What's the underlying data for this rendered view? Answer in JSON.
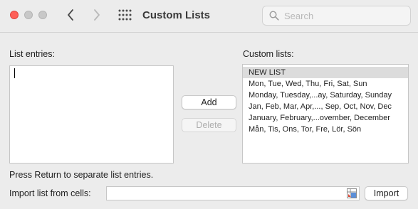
{
  "window": {
    "title": "Custom Lists"
  },
  "toolbar": {
    "back_icon": "chevron-left-icon",
    "forward_icon": "chevron-right-icon",
    "show_all_icon": "grid-icon"
  },
  "search": {
    "placeholder": "Search",
    "value": ""
  },
  "list_entries": {
    "label": "List entries:",
    "value": ""
  },
  "buttons": {
    "add": "Add",
    "delete": "Delete",
    "import": "Import"
  },
  "custom_lists": {
    "label": "Custom lists:",
    "items": [
      "NEW LIST",
      "Mon, Tue, Wed, Thu, Fri, Sat, Sun",
      "Monday, Tuesday,...ay, Saturday, Sunday",
      "Jan, Feb, Mar, Apr,..., Sep, Oct, Nov, Dec",
      "January, February,...ovember, December",
      "Mån, Tis, Ons, Tor, Fre, Lör, Sön"
    ],
    "selected_index": 0
  },
  "hint": "Press Return to separate list entries.",
  "import": {
    "label": "Import list from cells:",
    "value": ""
  },
  "colors": {
    "close": "#fe5f57",
    "inactive_light": "#c8c8c8",
    "selection": "#dcdcdc"
  }
}
